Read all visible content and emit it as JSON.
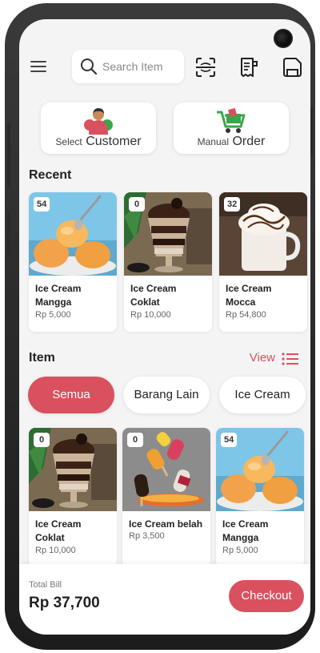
{
  "search": {
    "placeholder": "Search Item"
  },
  "actions": {
    "select_customer": {
      "small": "Select",
      "big": "Customer"
    },
    "manual_order": {
      "small": "Manual",
      "big": "Order"
    }
  },
  "recent": {
    "title": "Recent",
    "items": [
      {
        "stock": "54",
        "name": "Ice Cream Mangga",
        "price": "Rp 5,000",
        "image": "mango-icecream"
      },
      {
        "stock": "0",
        "name": "Ice Cream Coklat",
        "price": "Rp 10,000",
        "image": "chocolate-parfait"
      },
      {
        "stock": "32",
        "name": "Ice Cream Mocca",
        "price": "Rp 54,800",
        "image": "mocca-cup"
      }
    ]
  },
  "items_section": {
    "title": "Item",
    "view_label": "View",
    "categories": [
      "Semua",
      "Barang Lain",
      "Ice Cream"
    ],
    "active_category": "Semua",
    "items": [
      {
        "stock": "0",
        "name": "Ice Cream Coklat",
        "price": "Rp 10,000",
        "image": "chocolate-parfait"
      },
      {
        "stock": "0",
        "name": "Ice Cream belah",
        "price": "Rp 3,500",
        "image": "popsicles"
      },
      {
        "stock": "54",
        "name": "Ice Cream Mangga",
        "price": "Rp 5,000",
        "image": "mango-icecream"
      }
    ]
  },
  "bill": {
    "label": "Total Bill",
    "value": "Rp 37,700",
    "checkout_label": "Checkout"
  },
  "colors": {
    "accent": "#d9515e",
    "background": "#f4f4f4"
  }
}
